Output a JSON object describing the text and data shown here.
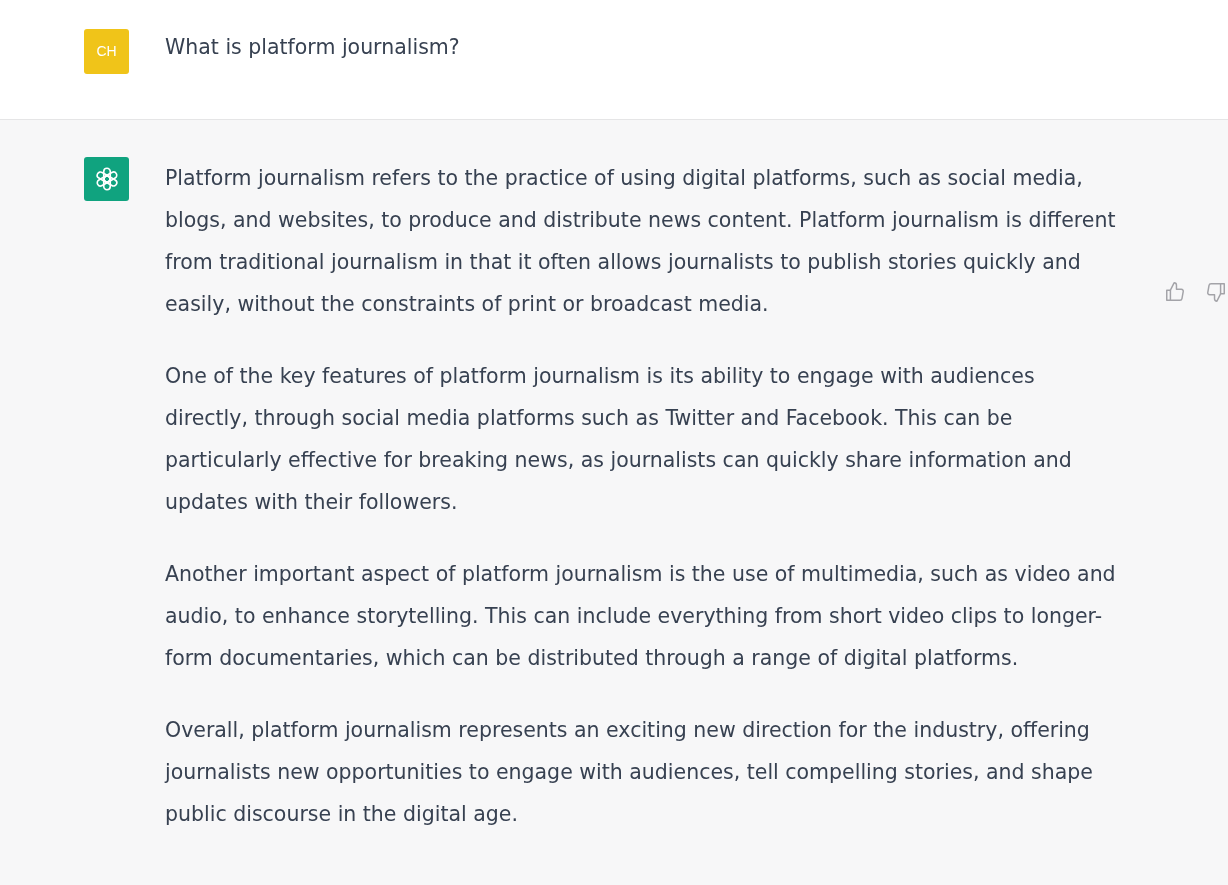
{
  "messages": [
    {
      "kind": "user",
      "avatar_initials": "CH",
      "paragraphs": [
        "What is platform journalism?"
      ]
    },
    {
      "kind": "assistant",
      "paragraphs": [
        "Platform journalism refers to the practice of using digital platforms, such as social media, blogs, and websites, to produce and distribute news content. Platform journalism is different from traditional journalism in that it often allows journalists to publish stories quickly and easily, without the constraints of print or broadcast media.",
        "One of the key features of platform journalism is its ability to engage with audiences directly, through social media platforms such as Twitter and Facebook. This can be particularly effective for breaking news, as journalists can quickly share information and updates with their followers.",
        "Another important aspect of platform journalism is the use of multimedia, such as video and audio, to enhance storytelling. This can include everything from short video clips to longer-form documentaries, which can be distributed through a range of digital platforms.",
        "Overall, platform journalism represents an exciting new direction for the industry, offering journalists new opportunities to engage with audiences, tell compelling stories, and shape public discourse in the digital age."
      ]
    }
  ]
}
